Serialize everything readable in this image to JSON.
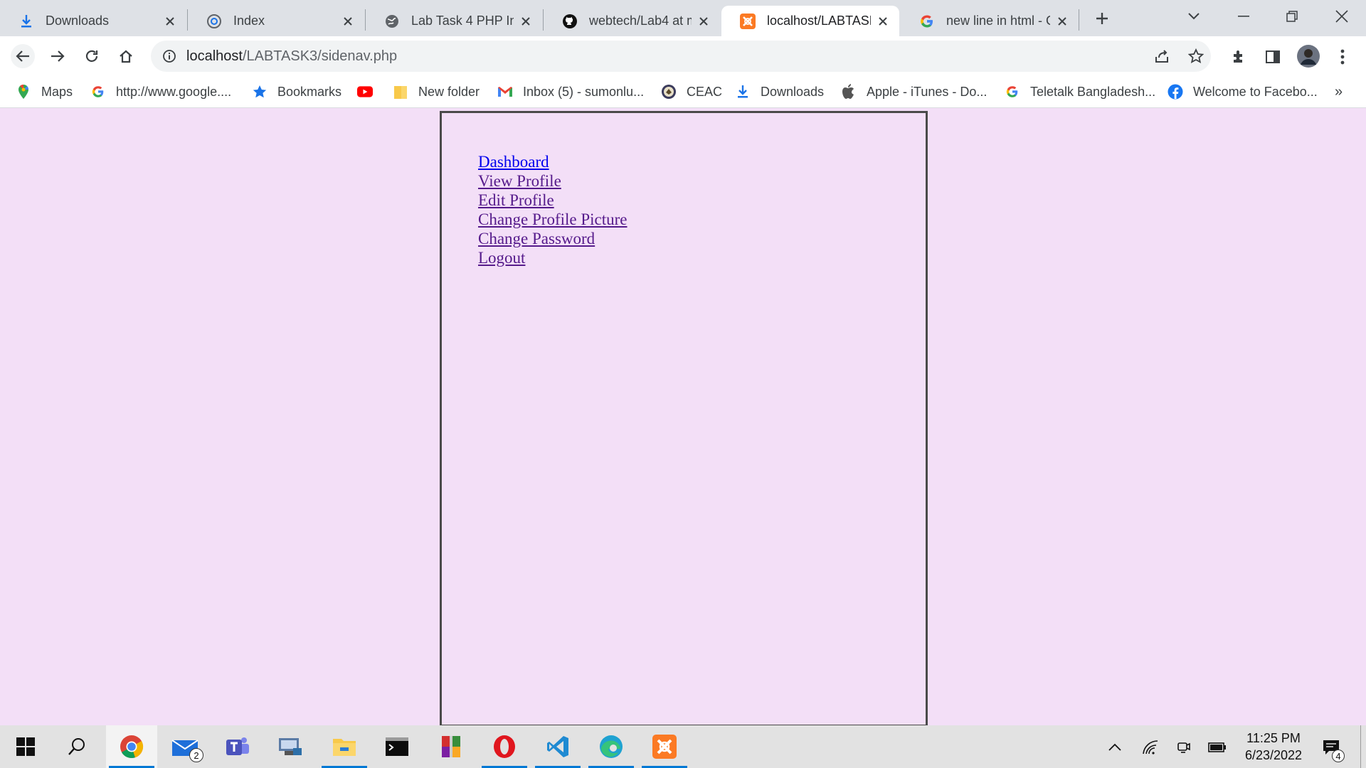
{
  "browser": {
    "tabs": [
      {
        "label": "Downloads",
        "icon": "download-icon"
      },
      {
        "label": "Index",
        "icon": "globe-icon"
      },
      {
        "label": "Lab Task 4 PHP Incl",
        "icon": "globe-icon"
      },
      {
        "label": "webtech/Lab4 at m",
        "icon": "github-icon"
      },
      {
        "label": "localhost/LABTASK3",
        "icon": "xampp-icon",
        "active": true
      },
      {
        "label": "new line in html - G",
        "icon": "google-icon"
      }
    ],
    "url_host": "localhost",
    "url_path": "/LABTASK3/sidenav.php",
    "bookmarks": [
      {
        "label": "Maps",
        "icon": "maps-icon"
      },
      {
        "label": "http://www.google....",
        "icon": "google-icon"
      },
      {
        "label": "Bookmarks",
        "icon": "star-icon"
      },
      {
        "label": "",
        "icon": "youtube-icon"
      },
      {
        "label": "New folder",
        "icon": "folder-icon"
      },
      {
        "label": "Inbox (5) - sumonlu...",
        "icon": "gmail-icon"
      },
      {
        "label": "CEAC",
        "icon": "seal-icon"
      },
      {
        "label": "Downloads",
        "icon": "download-icon"
      },
      {
        "label": "Apple - iTunes - Do...",
        "icon": "apple-icon"
      },
      {
        "label": "Teletalk Bangladesh...",
        "icon": "google-icon"
      },
      {
        "label": "Welcome to Facebo...",
        "icon": "facebook-icon"
      }
    ],
    "bookmarks_overflow": "»"
  },
  "sidenav": {
    "links": [
      {
        "label": "Dashboard"
      },
      {
        "label": "View Profile"
      },
      {
        "label": "Edit Profile"
      },
      {
        "label": "Change Profile Picture"
      },
      {
        "label": "Change Password"
      },
      {
        "label": "Logout"
      }
    ]
  },
  "taskbar": {
    "mail_badge": "2",
    "time": "11:25 PM",
    "date": "6/23/2022",
    "notification_count": "4"
  },
  "colors": {
    "page_background": "#f3dff7",
    "link": "#0000ee",
    "visited_link": "#551a8b"
  }
}
